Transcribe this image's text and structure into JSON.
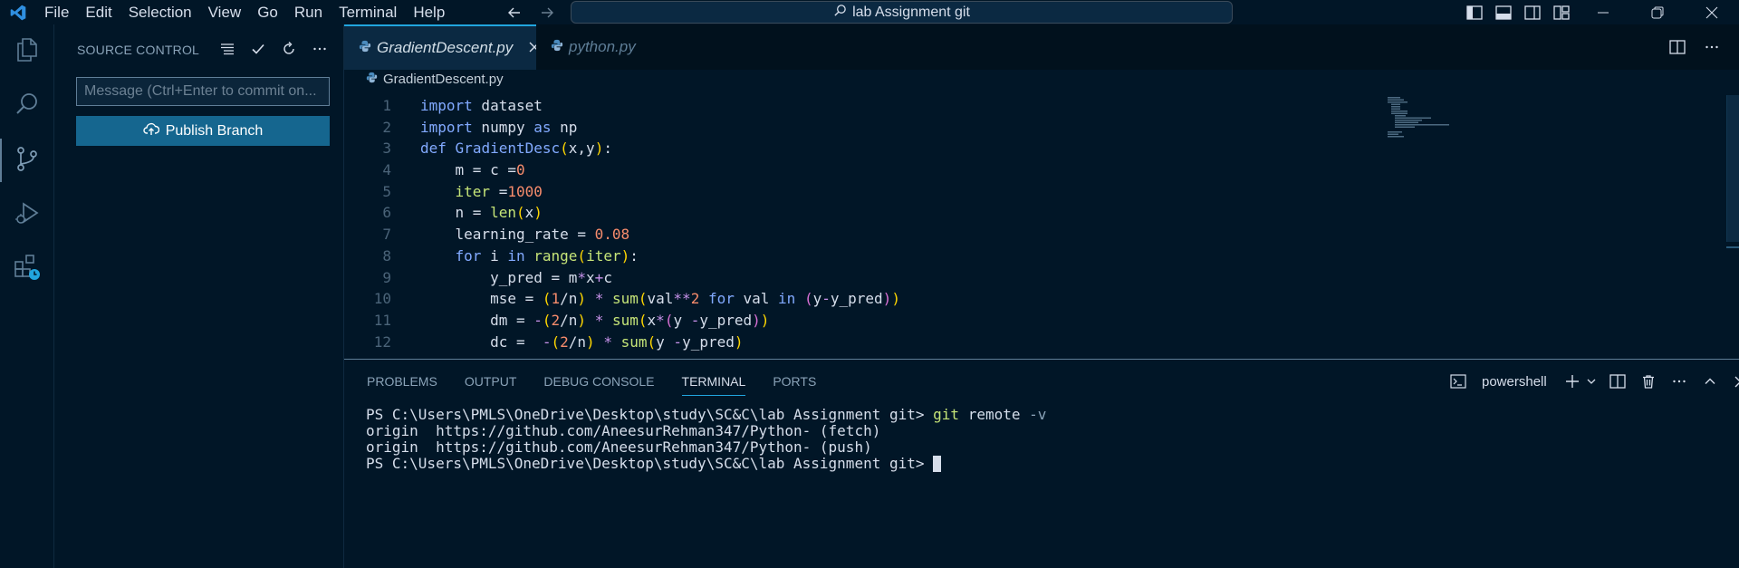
{
  "menu": {
    "items": [
      "File",
      "Edit",
      "Selection",
      "View",
      "Go",
      "Run",
      "Terminal",
      "Help"
    ]
  },
  "search": {
    "label": "lab Assignment git"
  },
  "sidebar": {
    "title": "SOURCE CONTROL",
    "commit_placeholder": "Message (Ctrl+Enter to commit on...",
    "publish_label": "Publish Branch"
  },
  "editor": {
    "tabs": [
      {
        "label": "GradientDescent.py",
        "active": true
      },
      {
        "label": "python.py",
        "active": false
      }
    ],
    "breadcrumb": "GradientDescent.py",
    "line_numbers": [
      "1",
      "2",
      "3",
      "4",
      "5",
      "6",
      "7",
      "8",
      "9",
      "10",
      "11",
      "12"
    ]
  },
  "panel": {
    "tabs": [
      "PROBLEMS",
      "OUTPUT",
      "DEBUG CONSOLE",
      "TERMINAL",
      "PORTS"
    ],
    "active_tab": "TERMINAL",
    "shell": "powershell",
    "terminal": {
      "prompt": "PS C:\\Users\\PMLS\\OneDrive\\Desktop\\study\\SC&C\\lab Assignment git>",
      "cmd": "git",
      "cmd_args": "remote",
      "cmd_flag": "-v",
      "out1": "origin  https://github.com/AneesurRehman347/Python- (fetch)",
      "out2": "origin  https://github.com/AneesurRehman347/Python- (push)"
    }
  },
  "colors": {
    "accent": "#21a5de",
    "button": "#15668f",
    "background": "#011627"
  }
}
